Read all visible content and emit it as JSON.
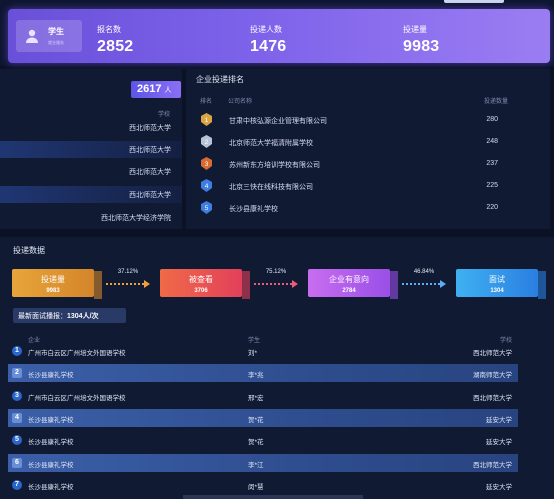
{
  "header": {
    "role": "学生",
    "role_sub": "就业服务",
    "stats": [
      {
        "label": "报名数",
        "value": "2852"
      },
      {
        "label": "投递人数",
        "value": "1476"
      },
      {
        "label": "投递量",
        "value": "9983"
      }
    ]
  },
  "left_panel": {
    "count": "2617",
    "count_unit": "人",
    "column_header": "学校",
    "schools": [
      "西北师范大学",
      "西北师范大学",
      "西北师范大学",
      "西北师范大学",
      "西北师范大学经济学院"
    ]
  },
  "ranking": {
    "title": "企业投递排名",
    "headers": {
      "rank": "排名",
      "company": "公司名称",
      "count": "投递数量"
    },
    "rows": [
      {
        "rank": "1",
        "company": "甘肃中核弘源企业管理有限公司",
        "count": "280",
        "color": "#d9a441"
      },
      {
        "rank": "2",
        "company": "北京师范大学福清附属学校",
        "count": "248",
        "color": "#b7c2d6"
      },
      {
        "rank": "3",
        "company": "苏州新东方培训学校有限公司",
        "count": "237",
        "color": "#d86a32"
      },
      {
        "rank": "4",
        "company": "北京三快在线科技有限公司",
        "count": "225",
        "color": "#3d7ee0"
      },
      {
        "rank": "5",
        "company": "长沙县康礼学校",
        "count": "220",
        "color": "#3d7ee0"
      }
    ]
  },
  "delivery": {
    "title": "投递数据",
    "funnel": [
      {
        "label": "投递量",
        "value": "9983",
        "color_a": "#e8a53a",
        "color_b": "#d4852a"
      },
      {
        "label": "被查看",
        "value": "3706",
        "color_a": "#f06a48",
        "color_b": "#e2405a"
      },
      {
        "label": "企业有意向",
        "value": "2784",
        "color_a": "#c86df0",
        "color_b": "#9a4fe6"
      },
      {
        "label": "面试",
        "value": "1304",
        "color_a": "#3fb0f2",
        "color_b": "#2a7fe0"
      }
    ],
    "rates": [
      {
        "value": "37.12%",
        "color": "#f0a03c"
      },
      {
        "value": "75.12%",
        "color": "#ef5a7a"
      },
      {
        "value": "46.84%",
        "color": "#5aaef5"
      }
    ],
    "latest_label": "最新面试播报：",
    "latest_value": "1304人/次",
    "columns": {
      "company": "企业",
      "student": "学生",
      "school": "学校"
    },
    "rows": [
      {
        "n": "1",
        "company": "广州市白云区广州培文外国语学校",
        "student": "刘*",
        "school": "西北师范大学"
      },
      {
        "n": "2",
        "company": "长沙县康礼学校",
        "student": "李*兆",
        "school": "湖南师范大学"
      },
      {
        "n": "3",
        "company": "广州市白云区广州培文外国语学校",
        "student": "邢*宏",
        "school": "西北师范大学"
      },
      {
        "n": "4",
        "company": "长沙县康礼学校",
        "student": "贺*花",
        "school": "延安大学"
      },
      {
        "n": "5",
        "company": "长沙县康礼学校",
        "student": "贺*花",
        "school": "延安大学"
      },
      {
        "n": "6",
        "company": "长沙县康礼学校",
        "student": "李*江",
        "school": "西北师范大学"
      },
      {
        "n": "7",
        "company": "长沙县康礼学校",
        "student": "闵*慧",
        "school": "延安大学"
      }
    ]
  }
}
